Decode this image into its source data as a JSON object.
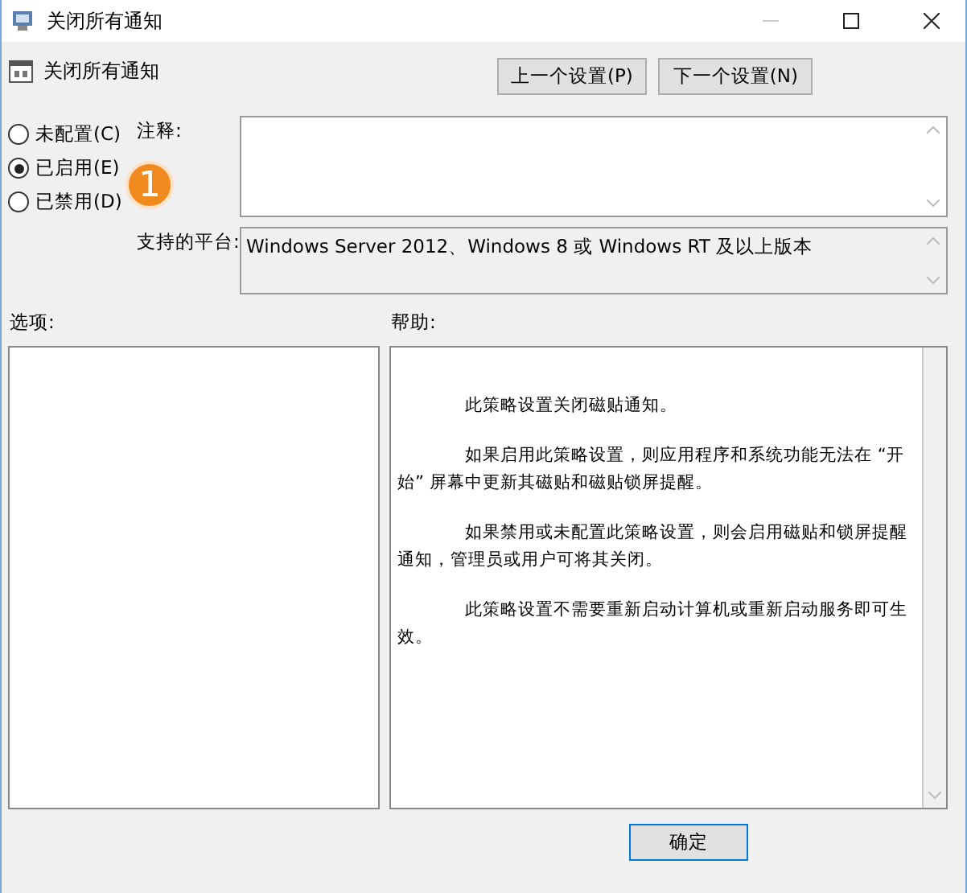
{
  "window": {
    "title": "关闭所有通知"
  },
  "header": {
    "title": "关闭所有通知",
    "buttons": [
      "上一个设置(P)",
      "下一个设置(N)"
    ]
  },
  "state_options": [
    {
      "label": "未配置(C)",
      "selected": false
    },
    {
      "label": "已启用(E)",
      "selected": true
    },
    {
      "label": "已禁用(D)",
      "selected": false
    }
  ],
  "callout": "1",
  "comment": {
    "label": "注释:"
  },
  "platform": {
    "label": "支持的平台:",
    "value": "Windows Server 2012、Windows 8 或 Windows RT 及以上版本"
  },
  "options": {
    "label": "选项:"
  },
  "help": {
    "label": "帮助:",
    "paragraphs": [
      "此策略设置关闭磁贴通知。",
      "如果启用此策略设置，则应用程序和系统功能无法在 “开始” 屏幕中更新其磁贴和磁贴锁屏提醒。",
      "如果禁用或未配置此策略设置，则会启用磁贴和锁屏提醒通知，管理员或用户可将其关闭。",
      "此策略设置不需要重新启动计算机或重新启动服务即可生效。"
    ]
  },
  "footer_buttons": [
    "确定"
  ]
}
